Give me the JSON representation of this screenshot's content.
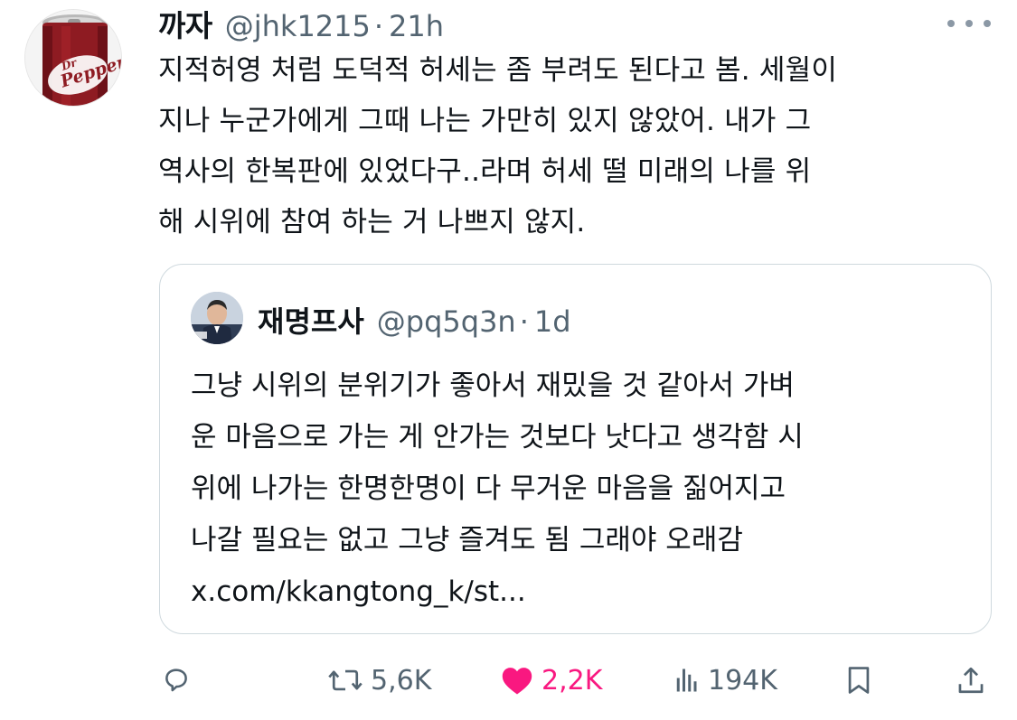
{
  "author": {
    "display_name": "까자",
    "handle": "@jhk1215",
    "separator": "·",
    "time": "21h",
    "avatar_text": "Dr Pepper"
  },
  "tweet": {
    "lines": [
      "지적허영 처럼 도덕적 허세는 좀 부려도 된다고 봄. 세월이",
      "지나 누군가에게 그때 나는 가만히 있지 않았어. 내가 그",
      "역사의 한복판에 있었다구..라며 허세 떨 미래의 나를 위",
      "해 시위에 참여 하는 거 나쁘지 않지."
    ]
  },
  "quote": {
    "display_name": "재명프사",
    "handle": "@pq5q3n",
    "separator": "·",
    "time": "1d",
    "lines": [
      "그냥 시위의 분위기가 좋아서 재밌을 것 같아서 가벼",
      "운 마음으로 가는 게 안가는 것보다 낫다고 생각함 시",
      "위에 나가는 한명한명이 다 무거운 마음을 짊어지고",
      "나갈 필요는 없고 그냥 즐겨도 됨 그래야 오래감"
    ],
    "link": "x.com/kkangtong_k/st..."
  },
  "actions": {
    "reply_icon": "reply-icon",
    "retweet_count": "5,6K",
    "like_count": "2,2K",
    "views_count": "194K",
    "bookmark_icon": "bookmark-icon",
    "share_icon": "share-icon"
  },
  "colors": {
    "text": "#0f1419",
    "secondary": "#536471",
    "like": "#f91880",
    "border": "#cfd9de"
  }
}
